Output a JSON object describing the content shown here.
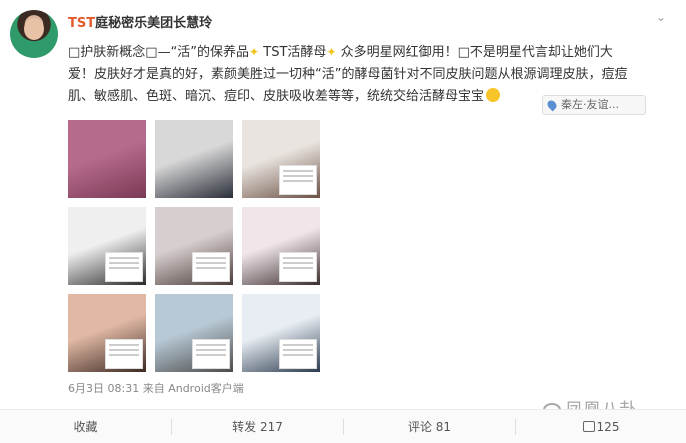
{
  "post": {
    "author": {
      "brand": "TST",
      "name": "庭秘密乐美团长慧玲"
    },
    "lines": [
      [
        "□护肤新概念□—“活”的保养品",
        "TST活酵母",
        "众多明星网红御用！□不是明星代言却让她们大"
      ],
      [
        "爱！皮肤好才是真的好，素颜美胜过一切种“活”的酵母菌针对不同皮肤问题从根源调理皮肤，痘痘"
      ],
      [
        "肌、敏感肌、色斑、暗沉、痘印、皮肤吸收差等等，统统交给活酵母宝宝"
      ]
    ],
    "location": "秦左·友谊...",
    "timestamp": "6月3日 08:31",
    "source": "来自 Android客户端"
  },
  "photos": [
    {
      "label": "photo-1",
      "colors": [
        "#b66a8c",
        "#7a3a55"
      ]
    },
    {
      "label": "photo-2",
      "colors": [
        "#d8d8d8",
        "#2a2e38"
      ]
    },
    {
      "label": "photo-3",
      "colors": [
        "#e9e4df",
        "#6b5045"
      ]
    },
    {
      "label": "photo-4",
      "colors": [
        "#efefef",
        "#2b2b2b"
      ]
    },
    {
      "label": "photo-5",
      "colors": [
        "#d7cfcf",
        "#4a3b38"
      ]
    },
    {
      "label": "photo-6",
      "colors": [
        "#f0e6ea",
        "#3a2d2d"
      ]
    },
    {
      "label": "photo-7",
      "colors": [
        "#e0b8a4",
        "#3d2a24"
      ]
    },
    {
      "label": "photo-8",
      "colors": [
        "#b8c9d6",
        "#4b4b4b"
      ]
    },
    {
      "label": "photo-9",
      "colors": [
        "#e7edf2",
        "#2b3a4f"
      ]
    }
  ],
  "actions": {
    "favorite": "收藏",
    "forward": "转发 217",
    "comment": "评论 81",
    "like": "125"
  },
  "watermark": "凤凰八卦",
  "icons": {
    "chevron": "chevron-down-icon",
    "sparkle": "sparkle-icon",
    "location": "location-pin-icon",
    "like": "thumbs-up-icon",
    "wechat": "wechat-icon"
  }
}
